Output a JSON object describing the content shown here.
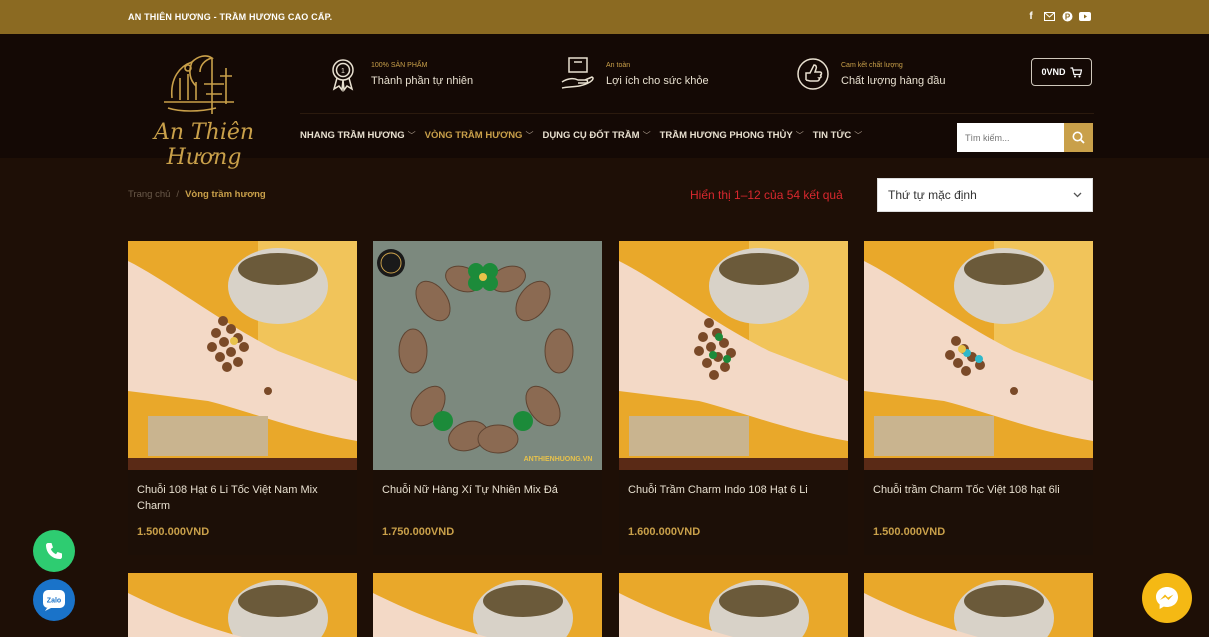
{
  "topbar": {
    "brand": "AN THIÊN HƯƠNG - TRẦM HƯƠNG CAO CẤP.",
    "socials": [
      "facebook-icon",
      "mail-icon",
      "pinterest-icon",
      "youtube-icon"
    ]
  },
  "header": {
    "logo_text": "An Thiên Hương",
    "features": [
      {
        "small": "100% SẢN PHẨM",
        "big": "Thành phần tự nhiên",
        "icon": "medal-icon"
      },
      {
        "small": "An toàn",
        "big": "Lợi ích cho sức khỏe",
        "icon": "hand-box-icon"
      },
      {
        "small": "Cam kết chất lượng",
        "big": "Chất lượng hàng đầu",
        "icon": "thumbs-up-icon"
      }
    ],
    "cart_label": "0VND"
  },
  "nav": {
    "items": [
      {
        "label": "NHANG TRẦM HƯƠNG",
        "active": false
      },
      {
        "label": "VÒNG TRẦM HƯƠNG",
        "active": true
      },
      {
        "label": "DỤNG CỤ ĐỐT TRẦM",
        "active": false
      },
      {
        "label": "TRẦM HƯƠNG PHONG THỦY",
        "active": false
      },
      {
        "label": "TIN TỨC",
        "active": false
      }
    ],
    "search_placeholder": "Tìm kiếm..."
  },
  "breadcrumb": {
    "home": "Trang chủ",
    "separator": "/",
    "current": "Vòng trầm hương"
  },
  "shop": {
    "result_count": "Hiển thị 1–12 của 54 kết quả",
    "sort_selected": "Thứ tự mặc định"
  },
  "products": [
    {
      "name": "Chuỗi 108 Hạt 6 Li Tốc Việt Nam Mix Charm",
      "price": "1.500.000VND"
    },
    {
      "name": "Chuỗi Nữ Hàng Xí Tự Nhiên Mix Đá",
      "price": "1.750.000VND"
    },
    {
      "name": "Chuỗi Trầm Charm Indo 108 Hạt 6 Li",
      "price": "1.600.000VND"
    },
    {
      "name": "Chuỗi trầm Charm Tốc Việt 108 hạt 6li",
      "price": "1.500.000VND"
    }
  ],
  "colors": {
    "gold": "#c9a04a",
    "topbar": "#8b6a22",
    "background": "#1e0f06",
    "result_red": "#d8282e",
    "phone_green": "#2ecc71",
    "zalo_blue": "#1a73c9",
    "messenger_yellow": "#f5b914"
  }
}
